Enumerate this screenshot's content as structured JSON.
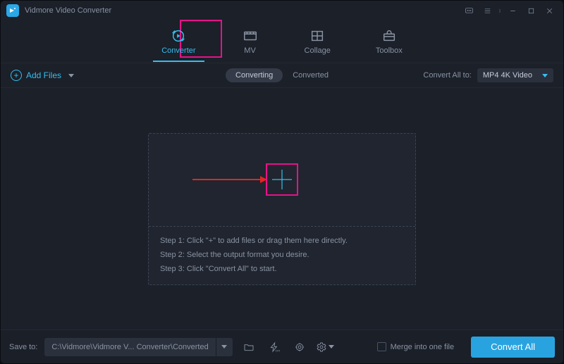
{
  "app": {
    "title": "Vidmore Video Converter"
  },
  "mainTabs": [
    {
      "label": "Converter",
      "active": true
    },
    {
      "label": "MV"
    },
    {
      "label": "Collage"
    },
    {
      "label": "Toolbox"
    }
  ],
  "toolbar": {
    "addFiles": "Add Files",
    "segments": {
      "converting": "Converting",
      "converted": "Converted"
    },
    "convertAllToLabel": "Convert All to:",
    "formatSelected": "MP4 4K Video"
  },
  "dropzone": {
    "step1": "Step 1: Click \"+\" to add files or drag them here directly.",
    "step2": "Step 2: Select the output format you desire.",
    "step3": "Step 3: Click \"Convert All\" to start."
  },
  "footer": {
    "saveToLabel": "Save to:",
    "path": "C:\\Vidmore\\Vidmore V... Converter\\Converted",
    "mergeLabel": "Merge into one file",
    "convertAll": "Convert All"
  }
}
